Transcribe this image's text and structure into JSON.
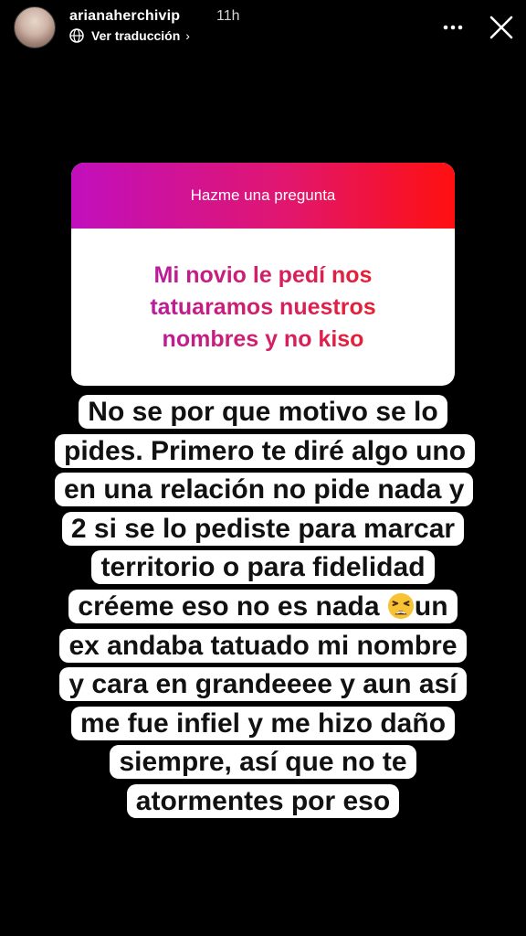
{
  "header": {
    "username": "arianaherchivip",
    "time": "11h",
    "translate_label": "Ver traducción",
    "translate_chevron": "›",
    "icons": [
      "avatar",
      "globe-icon",
      "more-icon",
      "close-icon"
    ]
  },
  "question_box": {
    "title": "Hazme una pregunta",
    "question": "Mi novio le pedí nos tatuaramos nuestros nombres y no kiso",
    "gradient_colors": [
      "#c10fbd",
      "#e01670",
      "#ff1010"
    ]
  },
  "answer": {
    "part1": "No se por que motivo se lo pides. Primero te diré algo uno en una relación no pide nada y 2 si se lo pediste para marcar territorio o para fidelidad créeme eso no es nada",
    "emoji": "tired-face-emoji",
    "part2": "un ex andaba tatuado mi nombre y cara en grandeeee y aun así me fue infiel y me hizo daño siempre, así que no te atormentes por eso"
  }
}
